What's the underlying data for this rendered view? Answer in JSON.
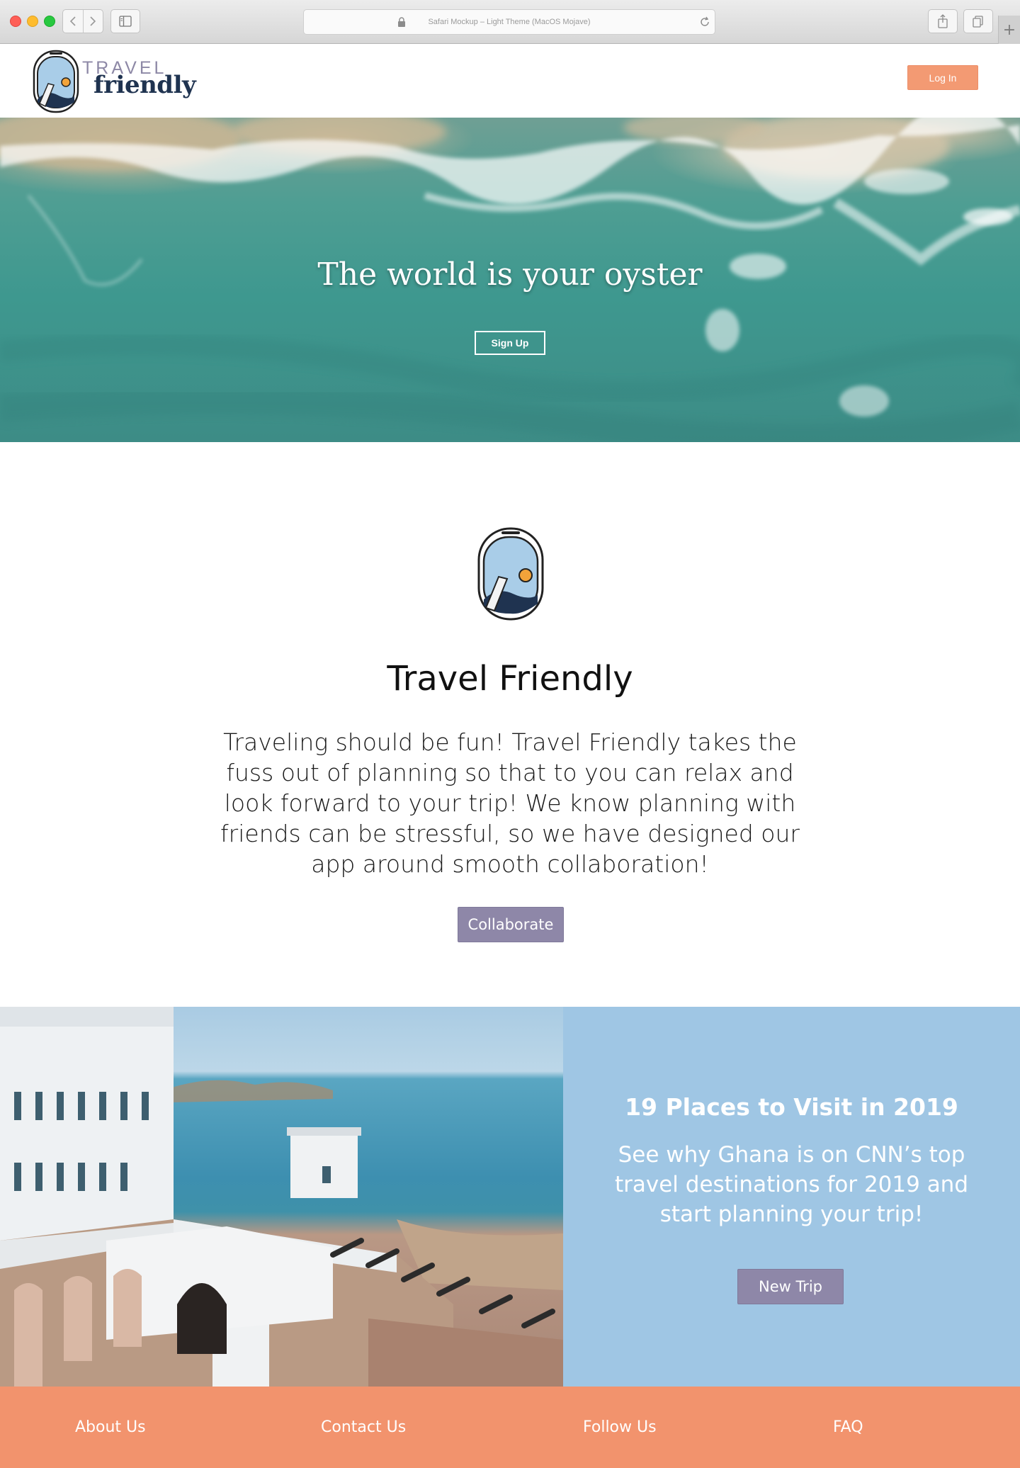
{
  "browser": {
    "address_text": "Safari Mockup – Light Theme (MacOS Mojave)",
    "new_tab_symbol": "+"
  },
  "header": {
    "logo_line_1": "TRAVEL",
    "logo_line_2": "friendly",
    "login_label": "Log In"
  },
  "hero": {
    "title": "The world is your oyster",
    "signup_label": "Sign Up"
  },
  "about": {
    "title": "Travel Friendly",
    "text": "Traveling should be fun! Travel Friendly takes the fuss out of planning  so that to you can relax and look forward to your trip! We know planning with friends can be stressful, so we have designed our app around smooth collaboration!",
    "button_label": "Collaborate"
  },
  "feature": {
    "title": "19 Places to Visit in 2019",
    "text": "See why Ghana is on CNN’s top travel destinations for 2019 and start planning your trip!",
    "button_label": "New Trip"
  },
  "footer": {
    "links": [
      "About Us",
      "Contact Us",
      "Follow Us",
      "FAQ"
    ]
  },
  "colors": {
    "accent_orange": "#f39a73",
    "button_purple": "#8e87a8",
    "panel_blue": "#9fc6e4",
    "footer_orange": "#f2936d",
    "logo_navy": "#1f3350"
  }
}
